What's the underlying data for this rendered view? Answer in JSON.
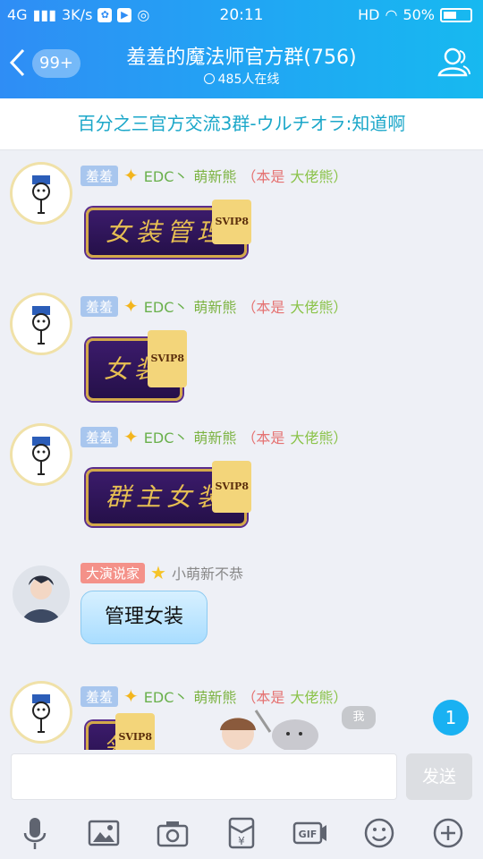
{
  "status": {
    "network": "4G",
    "speed": "3K/s",
    "time": "20:11",
    "hd": "HD",
    "battery": "50%",
    "battery_level": 0.5
  },
  "header": {
    "back_icon": "chevron-left-icon",
    "unread_badge": "99+",
    "title": "羞羞的魔法师官方群(756)",
    "online": "485人在线",
    "profile_icon": "group-members-icon",
    "colors": {
      "bar_start": "#2f8df5",
      "bar_end": "#17b9f0"
    }
  },
  "banner": {
    "text": "百分之三官方交流3群-ウルチオラ:知道啊"
  },
  "messages": [
    {
      "title_tag": "羞羞",
      "name_parts": [
        "EDC丶",
        "萌新熊",
        "（本是",
        "大佬熊）"
      ],
      "sticker": "女装管理",
      "svip": "SVIP8"
    },
    {
      "title_tag": "羞羞",
      "name_parts": [
        "EDC丶",
        "萌新熊",
        "（本是",
        "大佬熊）"
      ],
      "sticker": "女装",
      "svip": "SVIP8"
    },
    {
      "title_tag": "羞羞",
      "name_parts": [
        "EDC丶",
        "萌新熊",
        "（本是",
        "大佬熊）"
      ],
      "sticker": "群主女装",
      "svip": "SVIP8"
    },
    {
      "title_tag": "大演说家",
      "name": "小萌新不恭",
      "text": "管理女装"
    },
    {
      "title_tag": "羞羞",
      "name_parts": [
        "EDC丶",
        "萌新熊",
        "（本是",
        "大佬熊）"
      ],
      "sticker": "领",
      "svip": "SVIP8"
    }
  ],
  "floating": {
    "unread_count": "1",
    "me_label": "我"
  },
  "input": {
    "placeholder": "",
    "send": "发送"
  },
  "toolbar": {
    "items": [
      "microphone-icon",
      "image-icon",
      "camera-icon",
      "red-packet-icon",
      "gif-icon",
      "emoji-icon",
      "plus-icon"
    ]
  }
}
